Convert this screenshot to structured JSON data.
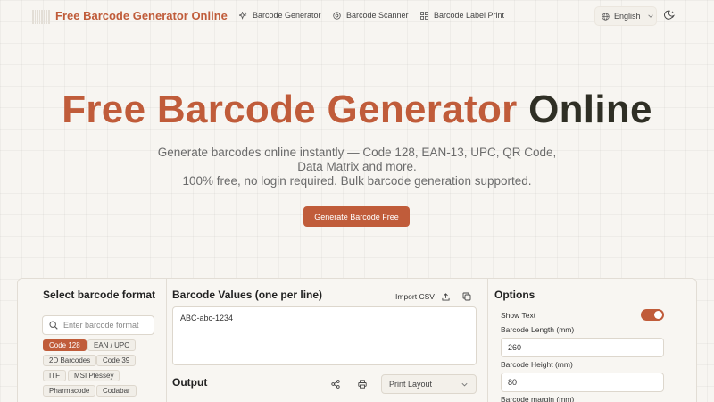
{
  "nav": {
    "brand": "Free Barcode Generator Online",
    "links": [
      {
        "label": "Barcode Generator",
        "icon": "sparkle-icon"
      },
      {
        "label": "Barcode Scanner",
        "icon": "scan-icon"
      },
      {
        "label": "Barcode Label Print",
        "icon": "grid-icon"
      }
    ],
    "language": "English",
    "theme_icon": "moon-icon"
  },
  "hero": {
    "title_accent": "Free Barcode Generator",
    "title_dark": "Online",
    "subtitle_line1": "Generate barcodes online instantly — Code 128, EAN-13, UPC, QR Code, Data Matrix and more.",
    "subtitle_line2": "100% free, no login required. Bulk barcode generation supported.",
    "cta_label": "Generate Barcode Free"
  },
  "format_panel": {
    "title": "Select barcode format",
    "search_placeholder": "Enter barcode format",
    "chips": [
      "Code 128",
      "EAN / UPC",
      "2D Barcodes",
      "Code 39",
      "ITF",
      "MSI Plessey",
      "Pharmacode",
      "Codabar"
    ],
    "selected": "Code 128"
  },
  "values_panel": {
    "title": "Barcode Values (one per line)",
    "import_label": "Import CSV",
    "value": "ABC-abc-1234",
    "output_title": "Output",
    "layout_select": "Print Layout"
  },
  "options_panel": {
    "title": "Options",
    "show_text_label": "Show Text",
    "show_text": true,
    "length_label": "Barcode Length (mm)",
    "length_value": "260",
    "height_label": "Barcode Height (mm)",
    "height_value": "80",
    "margin_label": "Barcode margin (mm)"
  },
  "colors": {
    "accent": "#c05c3a",
    "dark_title": "#2f2f25",
    "background": "#f7f5f1"
  }
}
